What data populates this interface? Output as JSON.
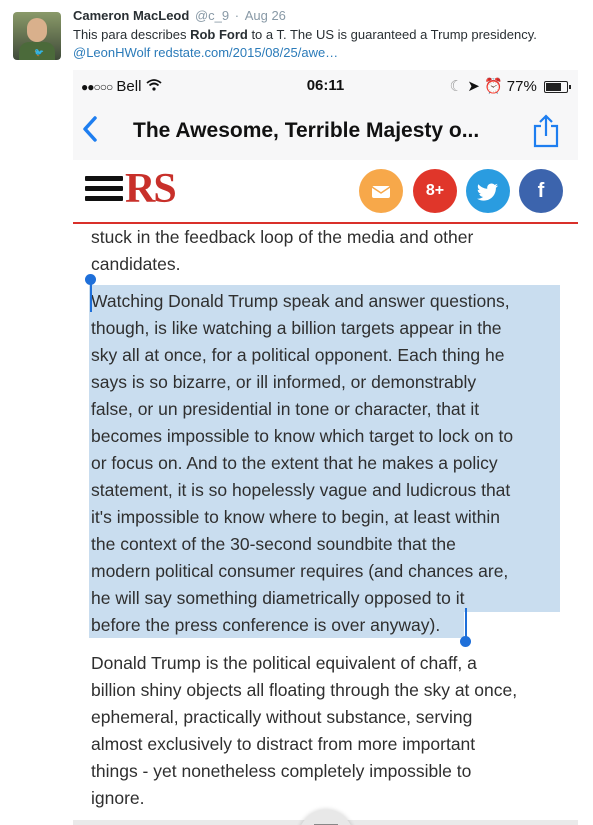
{
  "tweet": {
    "name": "Cameron MacLeod",
    "handle": "@c_9",
    "separator": "·",
    "date": "Aug 26",
    "text_pre": "This para describes ",
    "text_bold": "Rob Ford",
    "text_mid": " to a T. The US is guaranteed a Trump presidency. ",
    "mention": "@LeonHWolf",
    "link": "redstate.com/2015/08/25/awe…"
  },
  "phone": {
    "status": {
      "carrier": "Bell",
      "signal_dots": "●●○○○",
      "time": "06:11",
      "battery": "77%",
      "battery_level": 0.77
    },
    "nav": {
      "back": "‹",
      "title": "The Awesome, Terrible Majesty o..."
    },
    "site": {
      "logo": "RS",
      "social": [
        "email-icon",
        "google-plus-icon",
        "twitter-icon",
        "facebook-icon"
      ],
      "gplus_label": "8+"
    },
    "article": {
      "p1": [
        "stuck in the feedback loop of the media and other",
        "candidates."
      ],
      "p2": [
        "Watching Donald Trump speak and answer questions,",
        "though, is like watching a billion targets appear in the",
        "sky all at once, for a political opponent. Each thing he",
        "says is so bizarre, or ill informed, or demonstrably",
        "false, or un presidential in tone or character, that it",
        "becomes impossible to know which target to lock on to",
        "or focus on. And to the extent that he makes a policy",
        "statement, it is so hopelessly vague and ludicrous that",
        "it's impossible to know where to begin, at least within",
        "the context of the 30-second soundbite that the",
        "modern political consumer requires (and chances are,",
        "he will say something diametrically opposed to it",
        "before the press conference is over anyway)."
      ],
      "p3": [
        "Donald Trump is the political equivalent of chaff, a",
        "billion shiny objects all floating through the sky at once,",
        "ephemeral, practically without substance, serving",
        "almost exclusively to distract from more important",
        "things - yet nonetheless completely impossible to",
        "ignore."
      ]
    }
  },
  "colors": {
    "link": "#2b7bb9",
    "selection": "#c9ddef",
    "handle": "#1e6fd9",
    "brand_red": "#c8302a"
  }
}
